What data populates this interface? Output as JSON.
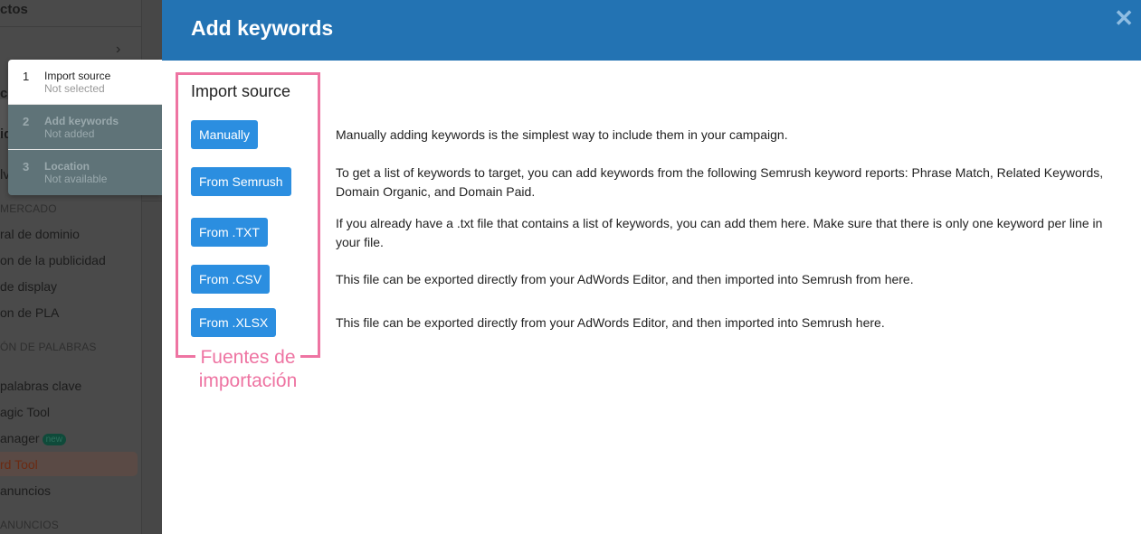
{
  "sidebar": {
    "items": [
      {
        "label": "ctos"
      },
      {
        "label": "c"
      },
      {
        "label": "id"
      },
      {
        "label": "lv"
      },
      {
        "label": "MERCADO"
      },
      {
        "label": "ral de dominio"
      },
      {
        "label": "on de la publicidad"
      },
      {
        "label": "de display"
      },
      {
        "label": "on de PLA"
      },
      {
        "label": "ÓN DE PALABRAS"
      },
      {
        "label": "palabras clave"
      },
      {
        "label": "agic Tool"
      },
      {
        "label": "anager",
        "badge": "new"
      },
      {
        "label": "rd Tool"
      },
      {
        "label": "anuncios"
      },
      {
        "label": "ANUNCIOS"
      }
    ],
    "chevron_icon": "chevron-right-icon"
  },
  "steps": [
    {
      "num": "1",
      "title": "Import source",
      "status": "Not selected"
    },
    {
      "num": "2",
      "title": "Add keywords",
      "status": "Not added"
    },
    {
      "num": "3",
      "title": "Location",
      "status": "Not available"
    }
  ],
  "modal": {
    "title": "Add keywords",
    "close_icon": "close-icon",
    "section_title": "Import source",
    "sources": [
      {
        "label": "Manually",
        "description": "Manually adding keywords is the simplest way to include them in your campaign."
      },
      {
        "label": "From Semrush",
        "description": "To get a list of keywords to target, you can add keywords from the following Semrush keyword reports: Phrase Match, Related Keywords, Domain Organic, and Domain Paid."
      },
      {
        "label": "From .TXT",
        "description": "If you already have a .txt file that contains a list of keywords, you can add them here. Make sure that there is only one keyword per line in your file."
      },
      {
        "label": "From .CSV",
        "description": "This file can be exported directly from your AdWords Editor, and then imported into Semrush from here."
      },
      {
        "label": "From .XLSX",
        "description": "This file can be exported directly from your AdWords Editor, and then imported into Semrush here."
      }
    ],
    "annotation": "Fuentes de importación"
  },
  "colors": {
    "header": "#2373b3",
    "button": "#2b8ee0",
    "annotation": "#ee74a2",
    "active_item": "#c2410c"
  }
}
